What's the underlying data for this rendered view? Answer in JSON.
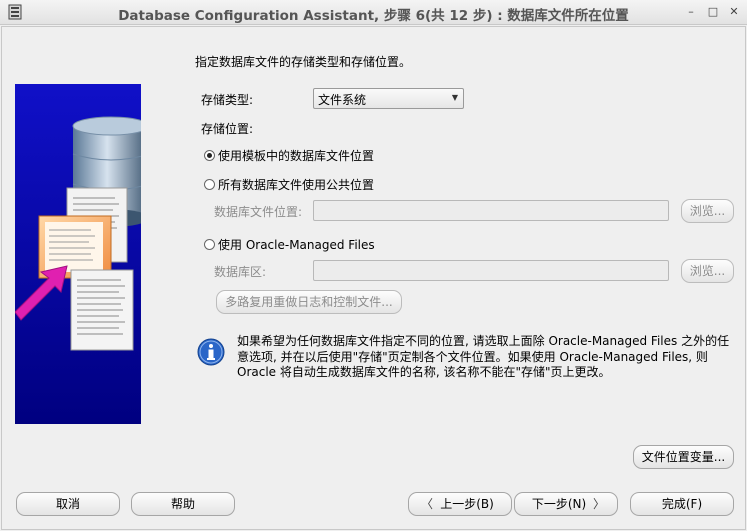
{
  "window": {
    "title": "Database Configuration Assistant, 步骤 6(共 12 步) : 数据库文件所在位置",
    "controls": [
      "minimize-icon",
      "maximize-icon",
      "close-icon"
    ]
  },
  "main": {
    "heading": "指定数据库文件的存储类型和存储位置。",
    "storage_type": {
      "label": "存储类型:",
      "value": "文件系统"
    },
    "storage_location_label": "存储位置:",
    "options": [
      {
        "label": "使用模板中的数据库文件位置",
        "selected": true
      },
      {
        "label": "所有数据库文件使用公共位置",
        "selected": false
      },
      {
        "label": "使用 Oracle-Managed Files",
        "selected": false
      }
    ],
    "db_file_location": {
      "label": "数据库文件位置:",
      "value": "",
      "browse": "浏览..."
    },
    "db_area": {
      "label": "数据库区:",
      "value": "",
      "browse": "浏览..."
    },
    "multiplex_button": "多路复用重做日志和控制文件...",
    "info_lines": [
      "如果希望为任何数据库文件指定不同的位置, 请选取上面除 Oracle-Managed Files 之外的任",
      "意选项, 并在以后使用\"存储\"页定制各个文件位置。如果使用 Oracle-Managed Files, 则",
      "Oracle 将自动生成数据库文件的名称, 该名称不能在\"存储\"页上更改。"
    ],
    "file_location_vars_button": "文件位置变量..."
  },
  "footer": {
    "cancel": "取消",
    "help": "帮助",
    "back": "上一步(B)",
    "next": "下一步(N)",
    "finish": "完成(F)"
  },
  "colors": {
    "side_panel_blue": "#0a0ab4",
    "arrow_magenta": "#e020b0",
    "info_blue": "#2a66c8"
  }
}
